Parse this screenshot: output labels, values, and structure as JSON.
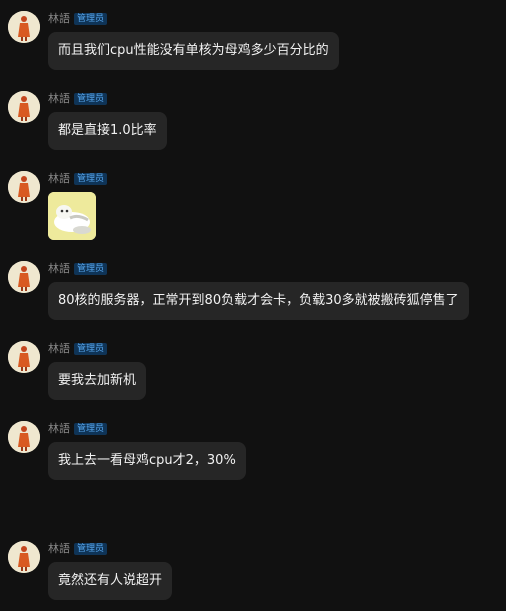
{
  "messages": [
    {
      "user": "林語",
      "role": "管理员",
      "text": "而且我们cpu性能没有单核为母鸡多少百分比的"
    },
    {
      "user": "林語",
      "role": "管理员",
      "text": "都是直接1.0比率"
    },
    {
      "user": "林語",
      "role": "管理员",
      "sticker": "cartoon-sticker"
    },
    {
      "user": "林語",
      "role": "管理员",
      "text": "80核的服务器，正常开到80负载才会卡，负载30多就被搬砖狐停售了"
    },
    {
      "user": "林語",
      "role": "管理员",
      "text": "要我去加新机"
    },
    {
      "user": "林語",
      "role": "管理员",
      "text": "我上去一看母鸡cpu才2，30%"
    },
    {
      "user": "林語",
      "role": "管理员",
      "text": "竟然还有人说超开"
    }
  ],
  "colors": {
    "background": "#111111",
    "bubble": "#262626",
    "badge_bg": "#0f3457",
    "badge_text": "#56a6ee"
  },
  "icons": {
    "avatar": "avatar-figure-icon",
    "sticker": "cartoon-sticker-icon"
  }
}
